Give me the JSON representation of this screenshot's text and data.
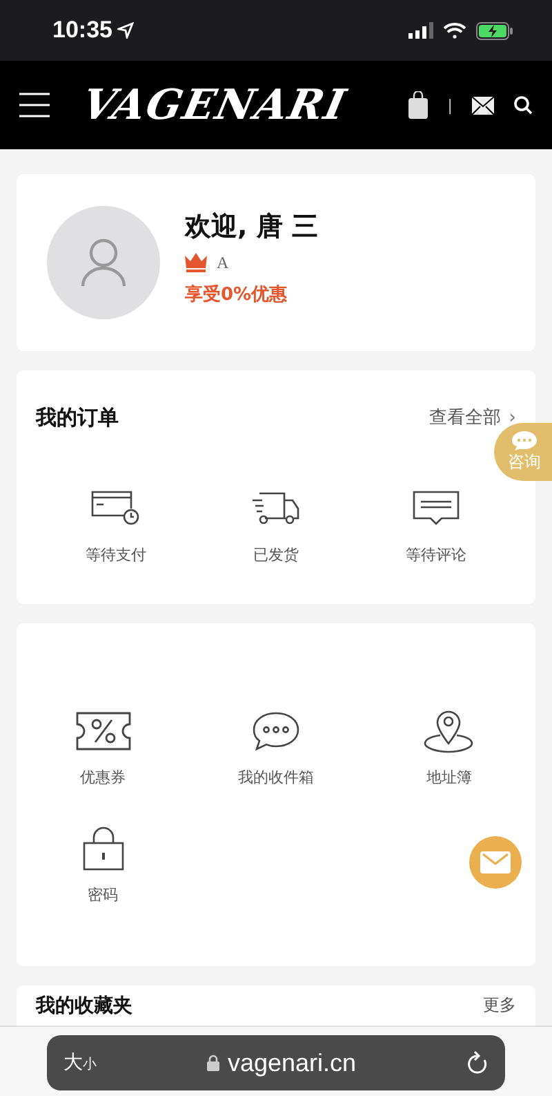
{
  "status_bar": {
    "time": "10:35"
  },
  "header": {
    "logo": "VAGENARI",
    "divider": "|"
  },
  "profile": {
    "greeting": "欢迎, 唐 三",
    "level": "A",
    "discount": "享受0%优惠"
  },
  "orders": {
    "title": "我的订单",
    "view_all": "查看全部",
    "chevron": "›",
    "items": [
      {
        "kind": "payment",
        "label": "等待支付"
      },
      {
        "kind": "shipped",
        "label": "已发货"
      },
      {
        "kind": "review",
        "label": "等待评论"
      }
    ]
  },
  "services": {
    "items": [
      {
        "kind": "coupon",
        "label": "优惠券"
      },
      {
        "kind": "inbox",
        "label": "我的收件箱"
      },
      {
        "kind": "address",
        "label": "地址簿"
      },
      {
        "kind": "password",
        "label": "密码"
      }
    ]
  },
  "favorites": {
    "title": "我的收藏夹",
    "more": "更多"
  },
  "consult_button": {
    "label": "咨询"
  },
  "browser_bar": {
    "text_size": [
      "大",
      "小"
    ],
    "url": "vagenari.cn"
  }
}
